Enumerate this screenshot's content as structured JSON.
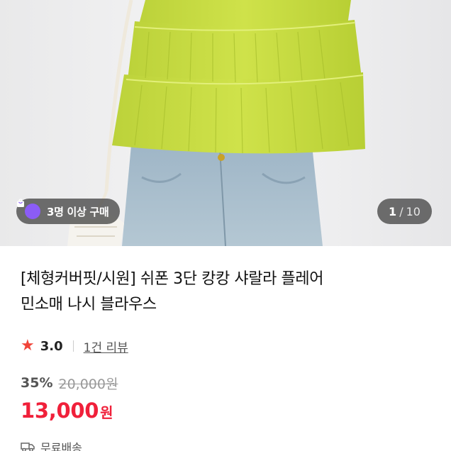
{
  "hero": {
    "buyers_badge": "3명 이상 구매",
    "pager": {
      "current": "1",
      "separator": "/",
      "total": "10"
    }
  },
  "product": {
    "title_line1": "[체형커버핏/시원] 쉬폰 3단 캉캉 샤랄라 플레어",
    "title_line2": "민소매 나시 블라우스",
    "rating": "3.0",
    "review_count": "1건 리뷰",
    "discount": "35%",
    "original_price": "20,000원",
    "sale_price": "13,000",
    "sale_price_unit": "원",
    "shipping": "무료배송"
  },
  "colors": {
    "accent_red": "#f0203a",
    "star_red": "#f04438",
    "badge_purple": "#8b5cf6",
    "blouse_lime": "#c9df3f"
  },
  "icons": {
    "badge": "shopping-bag-icon",
    "rating": "star-icon",
    "shipping": "truck-icon"
  }
}
